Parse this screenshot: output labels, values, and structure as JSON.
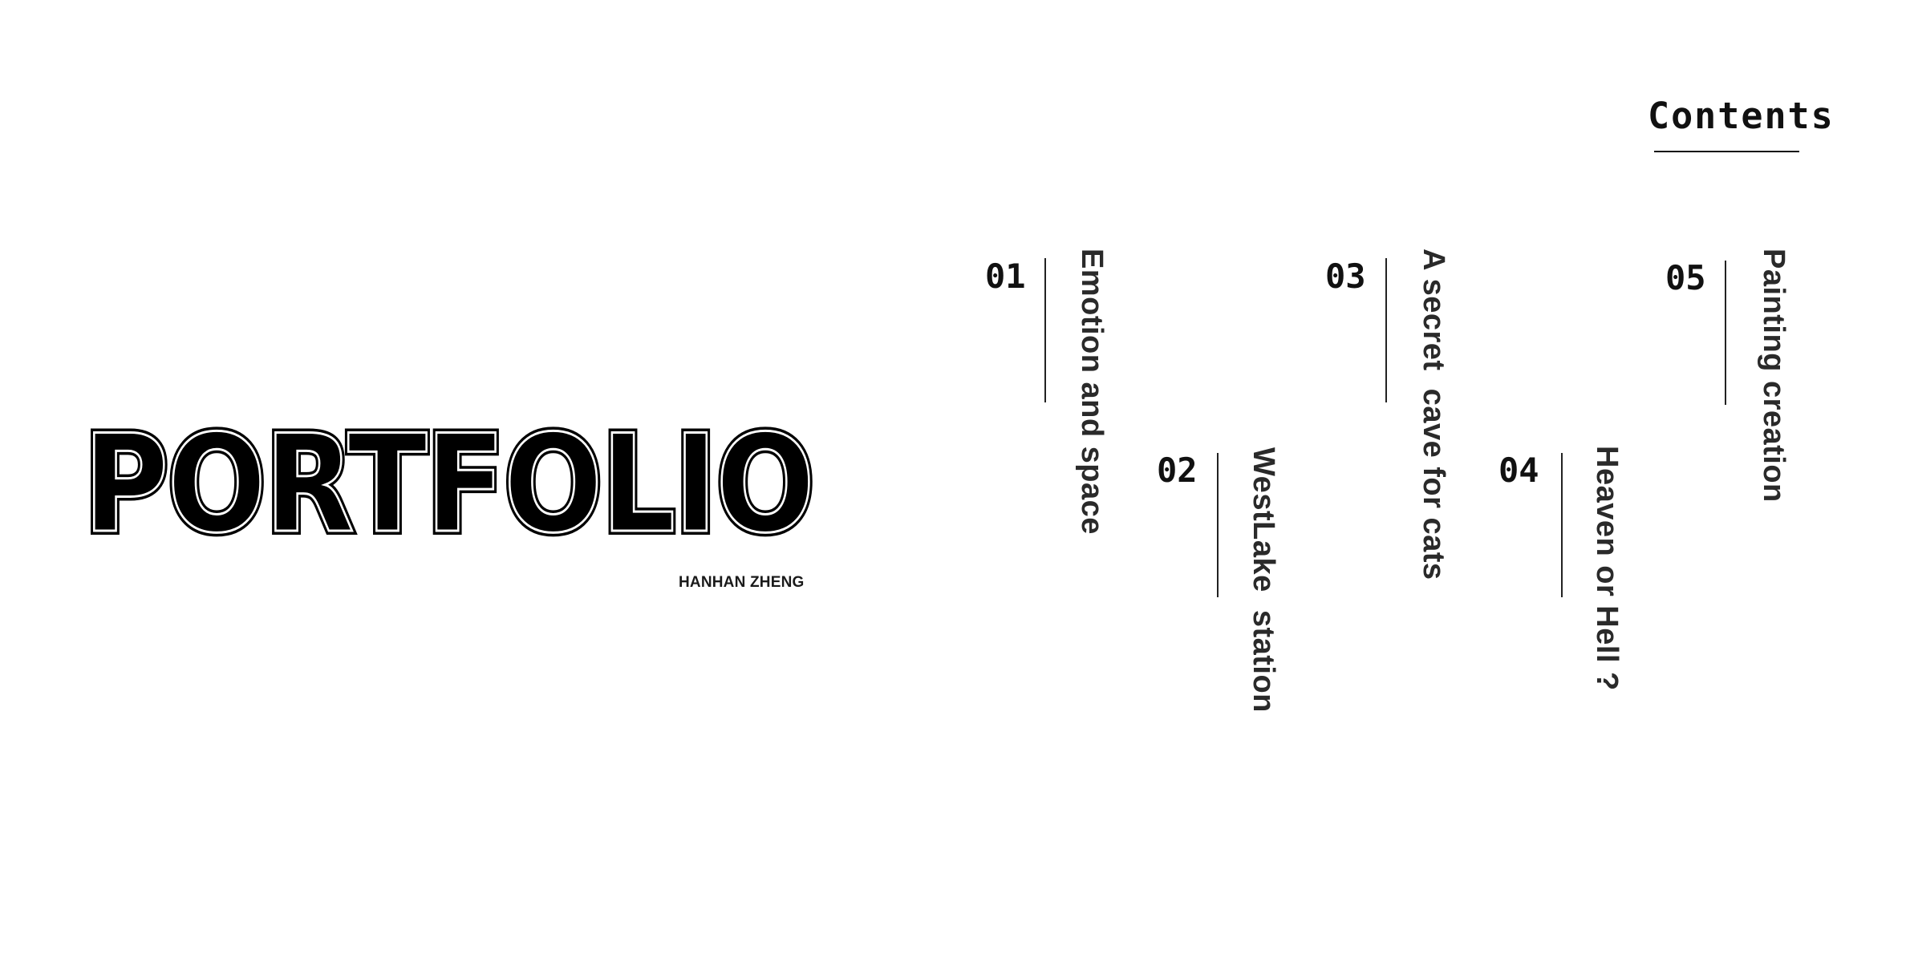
{
  "cover": {
    "title": "PORTFOLIO",
    "author": "HANHAN ZHENG"
  },
  "contents": {
    "heading": "Contents",
    "items": [
      {
        "number": "01",
        "title": "Emotion and space"
      },
      {
        "number": "02",
        "title": "WestLake  station"
      },
      {
        "number": "03",
        "title": "A secret  cave for cats"
      },
      {
        "number": "04",
        "title": "Heaven or Hell ?"
      },
      {
        "number": "05",
        "title": "Painting creation"
      }
    ]
  },
  "colors": {
    "text": "#111111",
    "background": "#ffffff"
  }
}
